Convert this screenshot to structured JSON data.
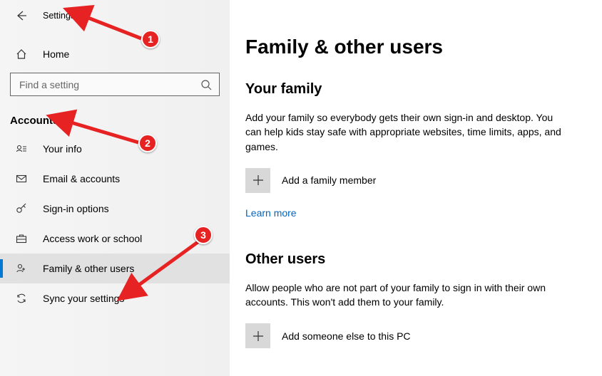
{
  "header": {
    "app_title": "Settings"
  },
  "sidebar": {
    "home_label": "Home",
    "search_placeholder": "Find a setting",
    "section_label": "Accounts",
    "items": [
      {
        "label": "Your info"
      },
      {
        "label": "Email & accounts"
      },
      {
        "label": "Sign-in options"
      },
      {
        "label": "Access work or school"
      },
      {
        "label": "Family & other users"
      },
      {
        "label": "Sync your settings"
      }
    ]
  },
  "main": {
    "page_title": "Family & other users",
    "family": {
      "heading": "Your family",
      "description": "Add your family so everybody gets their own sign-in and desktop. You can help kids stay safe with appropriate websites, time limits, apps, and games.",
      "add_label": "Add a family member",
      "learn_more": "Learn more"
    },
    "others": {
      "heading": "Other users",
      "description": "Allow people who are not part of your family to sign in with their own accounts. This won't add them to your family.",
      "add_label": "Add someone else to this PC"
    }
  },
  "annotations": {
    "n1": "1",
    "n2": "2",
    "n3": "3"
  }
}
